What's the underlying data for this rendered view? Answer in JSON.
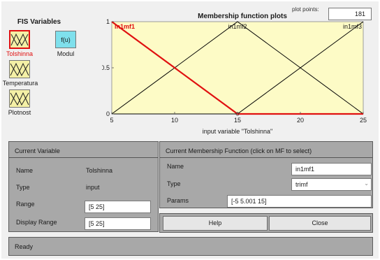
{
  "fis_variables": {
    "title": "FIS Variables",
    "inputs": [
      "Tolshinna",
      "Temperatura",
      "Plotnost"
    ],
    "selected": "Tolshinna",
    "output_block_label": "f(u)",
    "output_label": "Modul"
  },
  "plot": {
    "title": "Membership function plots",
    "plot_points_label": "plot points:",
    "plot_points_value": "181",
    "xlabel": "input variable \"Tolshinna\"",
    "x_ticks": [
      "5",
      "10",
      "15",
      "20",
      "25"
    ],
    "y_ticks": [
      "0",
      "0.5",
      "1"
    ],
    "mf_names": [
      "in1mf1",
      "in1mf2",
      "in1mf3"
    ]
  },
  "chart_data": {
    "type": "line",
    "xlim": [
      5,
      25
    ],
    "ylim": [
      0,
      1
    ],
    "series": [
      {
        "name": "in1mf1",
        "x": [
          5,
          15,
          25
        ],
        "y": [
          1,
          0,
          0
        ],
        "selected": true
      },
      {
        "name": "in1mf2",
        "x": [
          5,
          15,
          25
        ],
        "y": [
          0,
          1,
          0
        ],
        "selected": false
      },
      {
        "name": "in1mf3",
        "x": [
          5,
          15,
          25
        ],
        "y": [
          0,
          0,
          1
        ],
        "selected": false
      }
    ],
    "selected_color": "#e01010",
    "default_color": "#000000",
    "background": "#fdfbc6"
  },
  "current_variable": {
    "title": "Current Variable",
    "name_label": "Name",
    "name_value": "Tolshinna",
    "type_label": "Type",
    "type_value": "input",
    "range_label": "Range",
    "range_value": "[5 25]",
    "display_range_label": "Display Range",
    "display_range_value": "[5 25]"
  },
  "current_mf": {
    "title": "Current Membership Function (click on MF to select)",
    "name_label": "Name",
    "name_value": "in1mf1",
    "type_label": "Type",
    "type_value": "trimf",
    "params_label": "Params",
    "params_value": "[-5 5.001 15]"
  },
  "buttons": {
    "help": "Help",
    "close": "Close"
  },
  "status": "Ready",
  "colors": {
    "panel": "#a8a8a8",
    "window": "#f0f0f0",
    "selected_box": "#e01010",
    "input_box": "#f4f0a6",
    "output_box": "#7fe0ec"
  }
}
